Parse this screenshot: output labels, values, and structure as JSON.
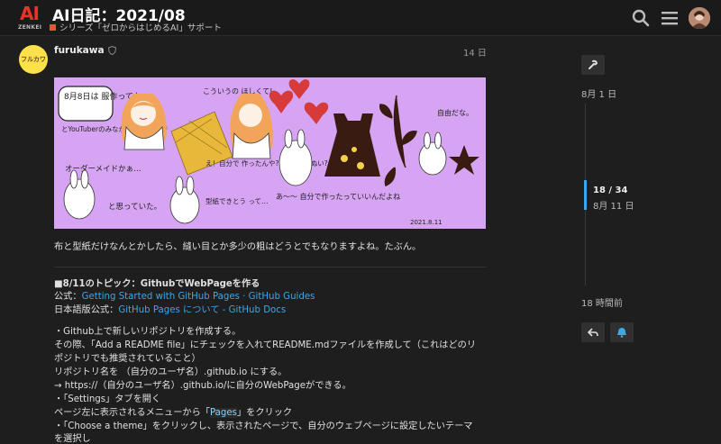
{
  "header": {
    "logo_text": "AI",
    "logo_sub": "ZENKEI",
    "title": "AI日記：2021/08",
    "category": "シリーズ「ゼロからはじめるAI」サポート",
    "icons": [
      "search-icon",
      "hamburger-menu-icon",
      "user-avatar"
    ]
  },
  "post": {
    "avatar_text": "フルカワ",
    "username": "furukawa",
    "date": "14 日",
    "illustration": {
      "notes": [
        "8月8日は 服作ってた",
        "こういうの ほしくて!",
        "とYouTuberのみなが 言ってたので",
        "オーダーメイドかぁ…",
        "と思っていた。",
        "え！自分で 作ったんや?! しかも手ぬい?",
        "型紙できとう って…",
        "あ〜〜 自分で作ったっていいんだよね",
        "自由だな。",
        "2021.8.11"
      ],
      "colors": {
        "background": "#d6a4f2",
        "hair": "#f2a55a",
        "heart": "#d63a3a",
        "dress": "#3a1b12"
      }
    },
    "line1": "布と型紙だけなんとかしたら、縫い目とか多少の粗はどうとでもなりますよね。たぶん。",
    "topic_heading": "■8/11のトピック：GithubでWebPageを作る",
    "official_label": "公式：",
    "official_link": "Getting Started with GitHub Pages · GitHub Guides",
    "jp_label": "日本語版公式：",
    "jp_link": "GitHub Pages について - GitHub Docs",
    "steps": [
      "・Github上で新しいリポジトリを作成する。",
      "その際、「Add a README file」にチェックを入れてREADME.mdファイルを作成して（これはどのリ",
      "ポジトリでも推奨されていること）",
      "リポジトリ名を （自分のユーザ名）.github.io にする。",
      "→ https://（自分のユーザ名）.github.io/に自分のWebPageができる。",
      "・「Settings」タブを開く"
    ],
    "step_pages_prefix": "ページ左に表示されるメニューから「",
    "step_pages_word": "Pages",
    "step_pages_suffix": "」をクリック",
    "steps_end": [
      "・「Choose a theme」をクリックし、表示されたページで、自分のウェブページに設定したいテーマ",
      "を選択し"
    ]
  },
  "timeline": {
    "start": "8月 1 日",
    "progress": "18 / 34",
    "current_date": "8月 11 日",
    "progress_fraction": 0.53,
    "ago": "18 時間前"
  },
  "colors": {
    "accent": "#3ea7e8",
    "category": "#e45735",
    "logo_red": "#e8332a"
  }
}
